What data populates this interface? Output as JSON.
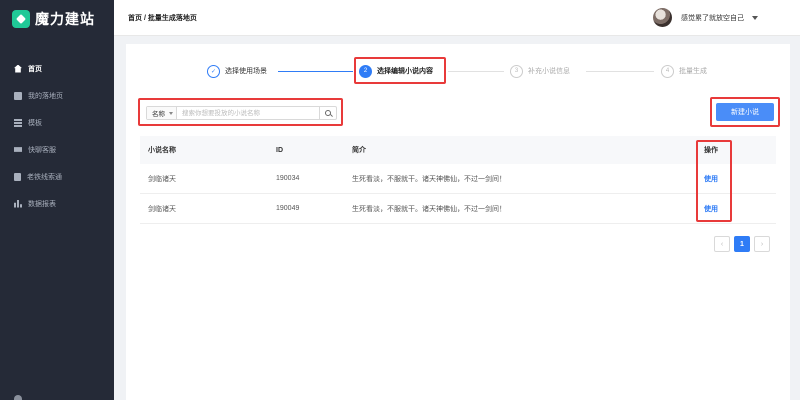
{
  "app": {
    "logo_text": "魔力建站"
  },
  "sidebar": {
    "items": [
      {
        "label": "首页",
        "icon": "home-icon",
        "active": true
      },
      {
        "label": "我的落地页",
        "icon": "page-icon",
        "active": false
      },
      {
        "label": "模板",
        "icon": "grid-icon",
        "active": false
      },
      {
        "label": "快聊客服",
        "icon": "service-icon",
        "active": false
      },
      {
        "label": "老铁线索通",
        "icon": "phone-icon",
        "active": false
      },
      {
        "label": "数据报表",
        "icon": "bar-chart-icon",
        "active": false
      }
    ]
  },
  "header": {
    "breadcrumb": "首页 / 批量生成落地页",
    "username": "感觉累了就放空自己"
  },
  "steps": [
    {
      "num": "✓",
      "label": "选择使用场景",
      "state": "done"
    },
    {
      "num": "2",
      "label": "选择编辑小说内容",
      "state": "active"
    },
    {
      "num": "3",
      "label": "补充小说信息",
      "state": "wait"
    },
    {
      "num": "4",
      "label": "批量生成",
      "state": "wait"
    }
  ],
  "search": {
    "field": "名称",
    "placeholder": "搜索你想要投放的小说名称"
  },
  "toolbar": {
    "new_label": "新建小说"
  },
  "table": {
    "headers": [
      "小说名称",
      "ID",
      "简介",
      "操作"
    ],
    "rows": [
      {
        "name": "剑临诸天",
        "id": "190034",
        "intro": "生死看淡，不服就干。诸天神佛仙，不过一剑间！",
        "action": "使用"
      },
      {
        "name": "剑临诸天",
        "id": "190049",
        "intro": "生死看淡，不服就干。诸天神佛仙，不过一剑间！",
        "action": "使用"
      }
    ]
  },
  "pagination": {
    "prev": "‹",
    "current": "1",
    "next": "›"
  },
  "colors": {
    "accent": "#2f7cf6",
    "highlight": "#e83a3a",
    "sidebar_bg": "#252a37"
  }
}
